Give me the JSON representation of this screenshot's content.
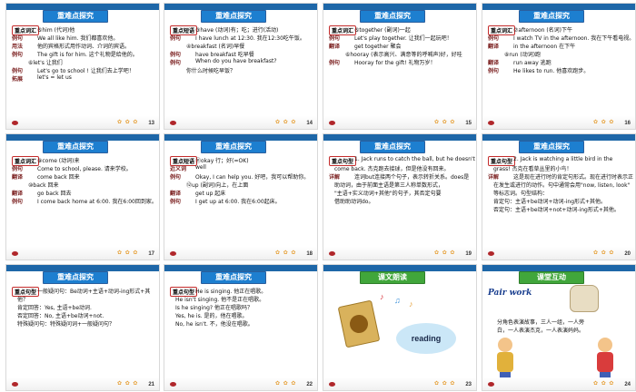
{
  "slides": [
    {
      "num": "13",
      "title": "重难点探究",
      "rows": [
        {
          "kind": "tag",
          "text": "重点词汇"
        },
        {
          "kind": "text",
          "text": "⑤him (代词)他"
        },
        {
          "kind": "lbl",
          "text": "例句"
        },
        {
          "kind": "text",
          "text": "We all like him. 我们都喜欢他。"
        },
        {
          "kind": "lbl",
          "text": "用法"
        },
        {
          "kind": "text",
          "text": "他的宾格形式用作动词、介词的宾语。"
        },
        {
          "kind": "lbl",
          "text": "例句"
        },
        {
          "kind": "text",
          "text": "The gift is for him. 这个礼物是给他的。"
        },
        {
          "kind": "text",
          "text": "⑥let's 让我们"
        },
        {
          "kind": "lbl",
          "text": "例句"
        },
        {
          "kind": "text",
          "text": "Let's go to school ! 让我们去上学吧！"
        },
        {
          "kind": "lbl",
          "text": "拓展"
        },
        {
          "kind": "text",
          "text": "let's = let us"
        }
      ]
    },
    {
      "num": "14",
      "title": "重难点探究",
      "rows": [
        {
          "kind": "tag",
          "text": "重点短语"
        },
        {
          "kind": "text",
          "text": "③have (动词)有；吃；进行(活动)"
        },
        {
          "kind": "lbl",
          "text": "例句"
        },
        {
          "kind": "text",
          "text": "I have lunch at 12:30. 我在12:30吃午饭。"
        },
        {
          "kind": "text",
          "text": "④breakfast (名词)早餐"
        },
        {
          "kind": "lbl",
          "text": "例句"
        },
        {
          "kind": "text",
          "text": "have breakfast 吃早餐"
        },
        {
          "kind": "lbl",
          "text": "例句"
        },
        {
          "kind": "text",
          "text": "When do you have breakfast?"
        },
        {
          "kind": "text",
          "text": "你什么时候吃早饭？"
        }
      ]
    },
    {
      "num": "15",
      "title": "重难点探究",
      "rows": [
        {
          "kind": "tag",
          "text": "重点词汇"
        },
        {
          "kind": "text",
          "text": "⑤together (副词)一起"
        },
        {
          "kind": "lbl",
          "text": "例句"
        },
        {
          "kind": "text",
          "text": "Let's play together. 让我们一起玩吧！"
        },
        {
          "kind": "lbl",
          "text": "翻译"
        },
        {
          "kind": "text",
          "text": "get together 聚会"
        },
        {
          "kind": "text",
          "text": "⑥hooray (表示高兴、满意等的呼喊声)好，好哇"
        },
        {
          "kind": "lbl",
          "text": "例句"
        },
        {
          "kind": "text",
          "text": "Hooray for the gift! 礼物万岁！"
        }
      ]
    },
    {
      "num": "16",
      "title": "重难点探究",
      "rows": [
        {
          "kind": "tag",
          "text": "重点词汇"
        },
        {
          "kind": "text",
          "text": "⑦afternoon (名词)下午"
        },
        {
          "kind": "lbl",
          "text": "例句"
        },
        {
          "kind": "text",
          "text": "I watch TV in the afternoon. 我在下午看电视。"
        },
        {
          "kind": "lbl",
          "text": "翻译"
        },
        {
          "kind": "text",
          "text": "in the afternoon 在下午"
        },
        {
          "kind": "text",
          "text": "⑧run (动词)跑"
        },
        {
          "kind": "lbl",
          "text": "翻译"
        },
        {
          "kind": "text",
          "text": "run away 逃跑"
        },
        {
          "kind": "lbl",
          "text": "例句"
        },
        {
          "kind": "text",
          "text": "He likes to run. 他喜欢跑步。"
        }
      ]
    },
    {
      "num": "17",
      "title": "重难点探究",
      "rows": [
        {
          "kind": "tag",
          "text": "重点词汇"
        },
        {
          "kind": "text",
          "text": "⑨come (动词)来"
        },
        {
          "kind": "lbl",
          "text": "例句"
        },
        {
          "kind": "text",
          "text": "Come to school, please. 请来学校。"
        },
        {
          "kind": "lbl",
          "text": "翻译"
        },
        {
          "kind": "text",
          "text": "come back 回来"
        },
        {
          "kind": "text",
          "text": "⑩back 回来"
        },
        {
          "kind": "lbl",
          "text": "翻译"
        },
        {
          "kind": "text",
          "text": "go back 回去"
        },
        {
          "kind": "lbl",
          "text": "例句"
        },
        {
          "kind": "text",
          "text": "I come back home at 6:00. 我在6:00回到家。"
        }
      ]
    },
    {
      "num": "18",
      "title": "重难点探究",
      "rows": [
        {
          "kind": "tag",
          "text": "重点短语"
        },
        {
          "kind": "text",
          "text": "⑪okay 行；好(=OK)"
        },
        {
          "kind": "lbl",
          "text": "近义词"
        },
        {
          "kind": "text",
          "text": "well"
        },
        {
          "kind": "lbl",
          "text": "例句"
        },
        {
          "kind": "text",
          "text": "Okay, I can help you. 好吧，我可以帮助你。"
        },
        {
          "kind": "text",
          "text": "⑫up (副词)向上，在上面"
        },
        {
          "kind": "lbl",
          "text": "翻译"
        },
        {
          "kind": "text",
          "text": "get up 起床"
        },
        {
          "kind": "lbl",
          "text": "例句"
        },
        {
          "kind": "text",
          "text": "I get up at 6:00. 我在6:00起床。"
        }
      ]
    },
    {
      "num": "19",
      "title": "重难点探究",
      "rows": [
        {
          "kind": "tag",
          "text": "重点句型"
        },
        {
          "kind": "text",
          "text": "1. Jack runs to catch the ball, but he doesn't"
        },
        {
          "kind": "text",
          "text": "come back. 杰克跑去接球，但是他没有回来。"
        },
        {
          "kind": "lbl",
          "text": "详解"
        },
        {
          "kind": "text",
          "text": "连词but连接两个句子，表示转折关系。does是"
        },
        {
          "kind": "text",
          "text": "助动词，由于前面主语是第三人称单数形式，"
        },
        {
          "kind": "text",
          "text": "\"主语+实义动词+其他\"的句子，其否定句要"
        },
        {
          "kind": "text",
          "text": "借助助动词do。"
        }
      ]
    },
    {
      "num": "20",
      "title": "重难点探究",
      "rows": [
        {
          "kind": "tag",
          "text": "重点句型"
        },
        {
          "kind": "text",
          "text": "2. Jack is watching a little bird in the"
        },
        {
          "kind": "text",
          "text": "grass! 杰克在看草丛里的小鸟！"
        },
        {
          "kind": "lbl",
          "text": "详解"
        },
        {
          "kind": "text",
          "text": "这是现在进行时的肯定句形式。现在进行时表示正"
        },
        {
          "kind": "text",
          "text": "在发生或进行的动作。句中通常会用\"now, listen, look\""
        },
        {
          "kind": "text",
          "text": "等标志词。句型结构："
        },
        {
          "kind": "text",
          "text": "肯定句：主语+be动词+动词-ing形式+其他。"
        },
        {
          "kind": "text",
          "text": "否定句：主语+be动词+not+动词-ing形式+其他。"
        }
      ]
    },
    {
      "num": "21",
      "title": "重难点探究",
      "rows": [
        {
          "kind": "tag",
          "text": "重点句型"
        },
        {
          "kind": "text",
          "text": "一般疑问句：Be动词+主语+动词-ing形式+其"
        },
        {
          "kind": "text",
          "text": "他？"
        },
        {
          "kind": "text",
          "text": "肯定回答：Yes, 主语+be动词."
        },
        {
          "kind": "text",
          "text": "否定回答：No, 主语+be动词+not."
        },
        {
          "kind": "text",
          "text": "特殊疑问句：特殊疑问词+一般疑问句？"
        }
      ]
    },
    {
      "num": "22",
      "title": "重难点探究",
      "rows": [
        {
          "kind": "tag",
          "text": "重点句型"
        },
        {
          "kind": "text",
          "text": "He is singing. 他正在唱歌。"
        },
        {
          "kind": "text",
          "text": "He isn't singing. 他不是正在唱歌。"
        },
        {
          "kind": "text",
          "text": "Is he singing? 他正在唱歌吗？"
        },
        {
          "kind": "text",
          "text": "Yes, he is. 是的，他在唱歌。"
        },
        {
          "kind": "text",
          "text": "No, he isn't. 不，他没在唱歌。"
        }
      ]
    },
    {
      "num": "23",
      "title": "课文朗读",
      "green": true,
      "reading": "reading"
    },
    {
      "num": "24",
      "title": "课堂互动",
      "green": true,
      "pairwork": "Pair work",
      "rows": [
        {
          "kind": "text",
          "text": "分角色表演故事，三人一组，一人旁"
        },
        {
          "kind": "text",
          "text": "白，一人表演杰克，一人表演妈妈。"
        }
      ]
    }
  ],
  "colors": {
    "topbar": "#1e67a8",
    "title_blue": "#1d7fd0",
    "title_green": "#41a63b",
    "label": "#7a1e1e"
  }
}
